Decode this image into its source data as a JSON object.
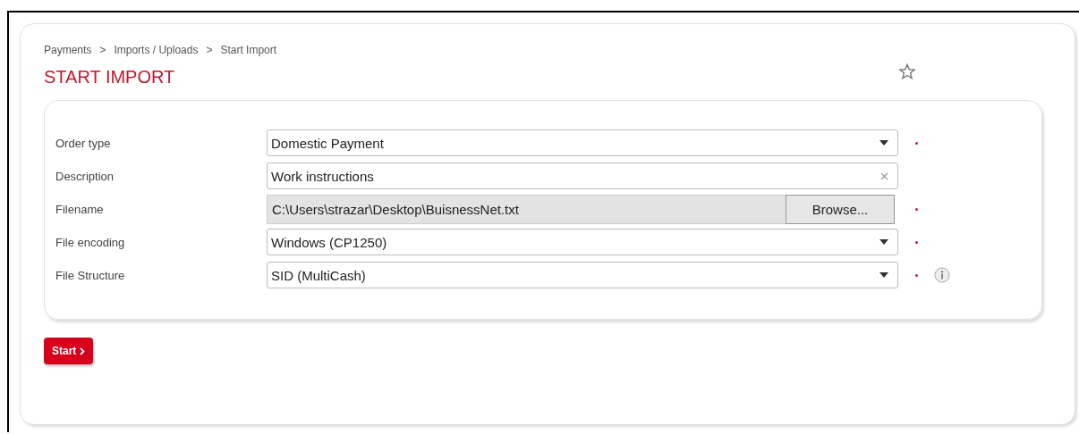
{
  "breadcrumb": [
    "Payments",
    "Imports / Uploads",
    "Start Import"
  ],
  "breadcrumb_separator": ">",
  "title": "START IMPORT",
  "favorite": false,
  "fields": [
    {
      "label": "Order type",
      "kind": "select",
      "value": "Domestic Payment",
      "required": true,
      "info": false
    },
    {
      "label": "Description",
      "kind": "text",
      "value": "Work instructions",
      "required": false,
      "info": false
    },
    {
      "label": "Filename",
      "kind": "file",
      "value": "C:\\Users\\strazar\\Desktop\\BuisnessNet.txt",
      "button": "Browse...",
      "required": true,
      "info": false
    },
    {
      "label": "File encoding",
      "kind": "select",
      "value": "Windows (CP1250)",
      "required": true,
      "info": false
    },
    {
      "label": "File Structure",
      "kind": "select",
      "value": "SID (MultiCash)",
      "required": true,
      "info": true
    }
  ],
  "start_button": "Start"
}
